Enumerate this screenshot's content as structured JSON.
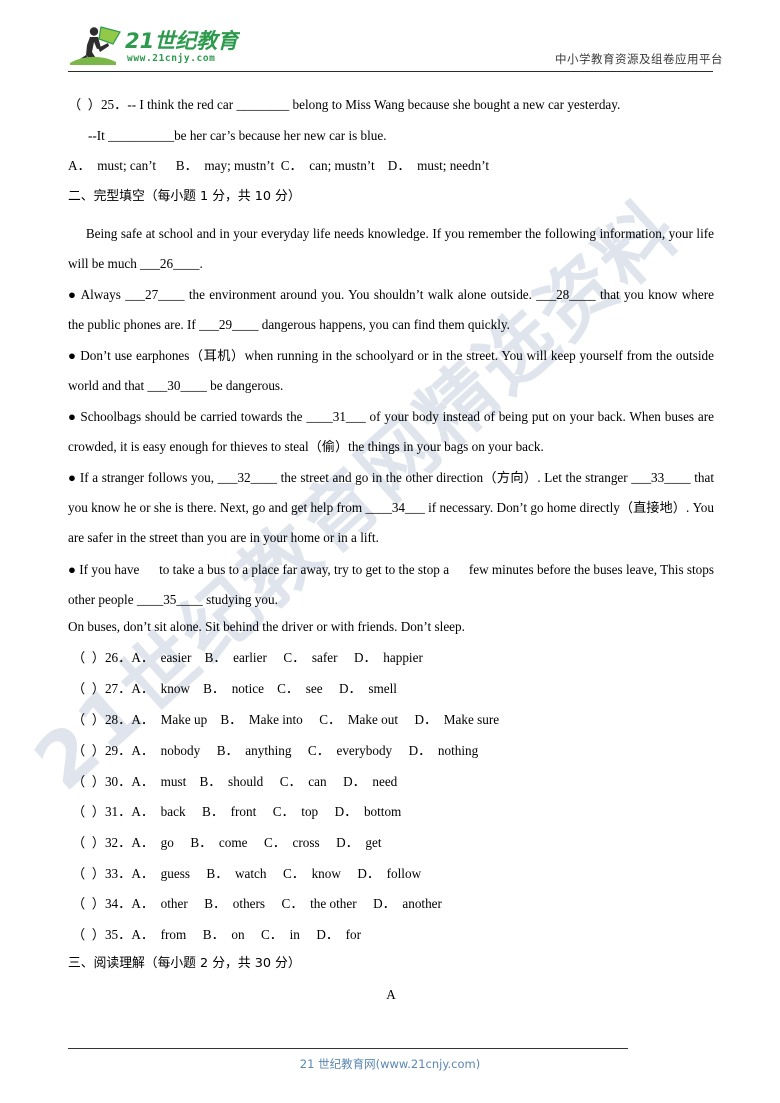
{
  "header": {
    "logo_text_main": "21世纪教育",
    "logo_text_sub": "www.21cnjy.com",
    "logo_color": "#2e9a4e",
    "tagline": "中小学教育资源及组卷应用平台"
  },
  "watermark": {
    "text": "21世纪教育网精选资料",
    "color": "#dde3ec"
  },
  "content": {
    "q25_line1": "（  ）25．-- I think the red car ________ belong to Miss Wang because she bought a new car yesterday.",
    "q25_line2": "--It __________be her car’s because her new car is blue.",
    "q25_options": "A．  must; can’t      B．  may; mustn’t  C．  can; mustn’t    D．  must; needn’t",
    "section2_heading": "二、完型填空（每小题 1 分，共 10 分）",
    "cloze_intro": "     Being safe at school and in your everyday life needs knowledge. If you remember the following information, your life will be much ___26____.",
    "bullet1": "● Always ___27____ the environment around you. You shouldn’t walk alone outside. ___28____ that you know where the public phones are. If ___29____ dangerous happens, you can find them quickly.",
    "bullet2": "● Don’t use earphones（耳机）when running in the schoolyard or in the street. You will keep yourself from the outside world and that ___30____ be dangerous.",
    "bullet3": "● Schoolbags should be carried towards the ____31___ of your body instead of being put on your back. When buses are crowded, it is easy enough for thieves to steal（偷）the things in your bags on your back.",
    "bullet4": "● If a stranger follows you, ___32____ the street and go in the other direction（方向）. Let the stranger ___33____ that you know he or she is there. Next, go and get help from ____34___ if necessary. Don’t go home directly（直接地）. You are safer in the street than you are in your home or in a lift.",
    "bullet5": "● If you have      to take a bus to a place far away, try to get to the stop a      few minutes before the buses leave, This stops other people ____35____ studying you.",
    "closing_line": "On buses, don’t sit alone. Sit behind the driver or with friends. Don’t sleep.",
    "section3_heading": "三、阅读理解（每小题 2 分，共 30 分）",
    "passage_label": "A"
  },
  "cloze_questions": [
    {
      "num": "（  ）26．",
      "a": "A．  easier",
      "b": "B．  earlier",
      "c": "C．  safer",
      "d": "D．  happier"
    },
    {
      "num": "（  ）27．",
      "a": "A．  know",
      "b": "B．  notice",
      "c": "C．  see",
      "d": "D．  smell"
    },
    {
      "num": "（  ）28．",
      "a": "A．  Make up",
      "b": "B．  Make into",
      "c": "C．  Make out",
      "d": "D．  Make sure"
    },
    {
      "num": "（  ）29．",
      "a": "A．  nobody",
      "b": "B．  anything",
      "c": "C．  everybody",
      "d": "D．  nothing"
    },
    {
      "num": "（  ）30．",
      "a": "A．  must",
      "b": "B．  should",
      "c": "C．  can",
      "d": "D．  need"
    },
    {
      "num": "（  ）31．",
      "a": "A．  back",
      "b": "B．  front",
      "c": "C．  top",
      "d": "D．  bottom"
    },
    {
      "num": "（  ）32．",
      "a": "A．  go",
      "b": "B．  come",
      "c": "C．  cross",
      "d": "D．  get"
    },
    {
      "num": "（  ）33．",
      "a": "A．  guess",
      "b": "B．  watch",
      "c": "C．  know",
      "d": "D．  follow"
    },
    {
      "num": "（  ）34．",
      "a": "A．  other",
      "b": "B．  others",
      "c": "C．  the other",
      "d": "D．  another"
    },
    {
      "num": "（  ）35．",
      "a": "A．  from",
      "b": "B．  on",
      "c": "C．  in",
      "d": "D．  for"
    }
  ],
  "cloze_rows_text": [
    "（  ）26．A．  easier    B．  earlier     C．  safer     D．  happier",
    "（  ）27．A．  know    B．  notice    C．  see     D．  smell",
    "（  ）28．A．  Make up    B．  Make into     C．  Make out     D．  Make sure",
    "（  ）29．A．  nobody     B．  anything     C．  everybody     D．  nothing",
    "（  ）30．A．  must    B．  should     C．  can     D．  need",
    "（  ）31．A．  back     B．  front     C．  top     D．  bottom",
    "（  ）32．A．  go     B．  come     C．  cross     D．  get",
    "（  ）33．A．  guess     B．  watch     C．  know     D．  follow",
    "（  ）34．A．  other     B．  others     C．  the other     D．  another",
    "（  ）35．A．  from     B．  on     C．  in     D．  for"
  ],
  "footer": {
    "text": "21 世纪教育网(www.21cnjy.com)",
    "color": "#5a87b0"
  }
}
